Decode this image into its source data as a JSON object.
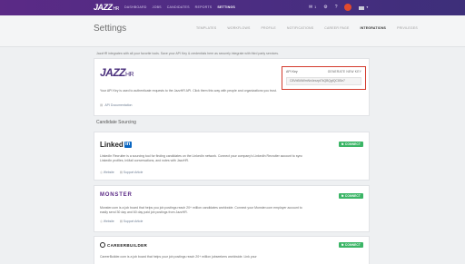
{
  "brand": {
    "logo": "JAZZ",
    "logo_suffix": "HR"
  },
  "nav": {
    "links": [
      "DASHBOARD",
      "JOBS",
      "CANDIDATES",
      "REPORTS",
      "SETTINGS"
    ],
    "active": "SETTINGS"
  },
  "topbar": {
    "mail_count": "1"
  },
  "page": {
    "title": "Settings"
  },
  "tabs": {
    "items": [
      "TEMPLATES",
      "WORKFLOWS",
      "PROFILE",
      "NOTIFICATIONS",
      "CAREER PAGE",
      "INTEGRATIONS",
      "PRIVILEGES"
    ],
    "active": "INTEGRATIONS"
  },
  "intro": {
    "text": "JazzHR integrates with all your favorite tools. Save your API Key & credentials here as securely integrate with third party services."
  },
  "jazzhr_card": {
    "logo": "JAZZ",
    "logo_suffix": "HR",
    "description": "Your API Key is used to authenticate requests to the JazzHR API. Click them this way with people and organizations you trust.",
    "doc_link": "API Documentation",
    "api_key_label": "API Key",
    "generate_label": "GENERATE NEW KEY",
    "api_key_value": "C8VbB4tWmNn4exzpt7kQBQgfQC8Se7"
  },
  "section": {
    "title": "Candidate Sourcing"
  },
  "linkedin_card": {
    "logo": "Linked",
    "logo_in": "in",
    "connect_label": "CONNECT",
    "description": "LinkedIn Recruiter is a sourcing tool for finding candidates on the LinkedIn network. Connect your company's LinkedIn Recruiter account to sync LinkedIn profiles, InMail conversations, and notes with JazzHR.",
    "links": [
      "Website",
      "Support Article"
    ]
  },
  "monster_card": {
    "logo": "MONSTER",
    "connect_label": "CONNECT",
    "description": "Monster.com is a job board that helps you job postings reach 20+ million candidates worldwide. Connect your Monster.com employer account to easily send 30 day and 60 day paid job postings from JazzHR.",
    "links": [
      "Website",
      "Support Article"
    ]
  },
  "careerbuilder_card": {
    "logo": "CAREERBUILDER",
    "connect_label": "CONNECT",
    "description": "CareerBuilder.com is a job board that helps your job postings reach 20+ million jobseekers worldwide. Link your"
  }
}
